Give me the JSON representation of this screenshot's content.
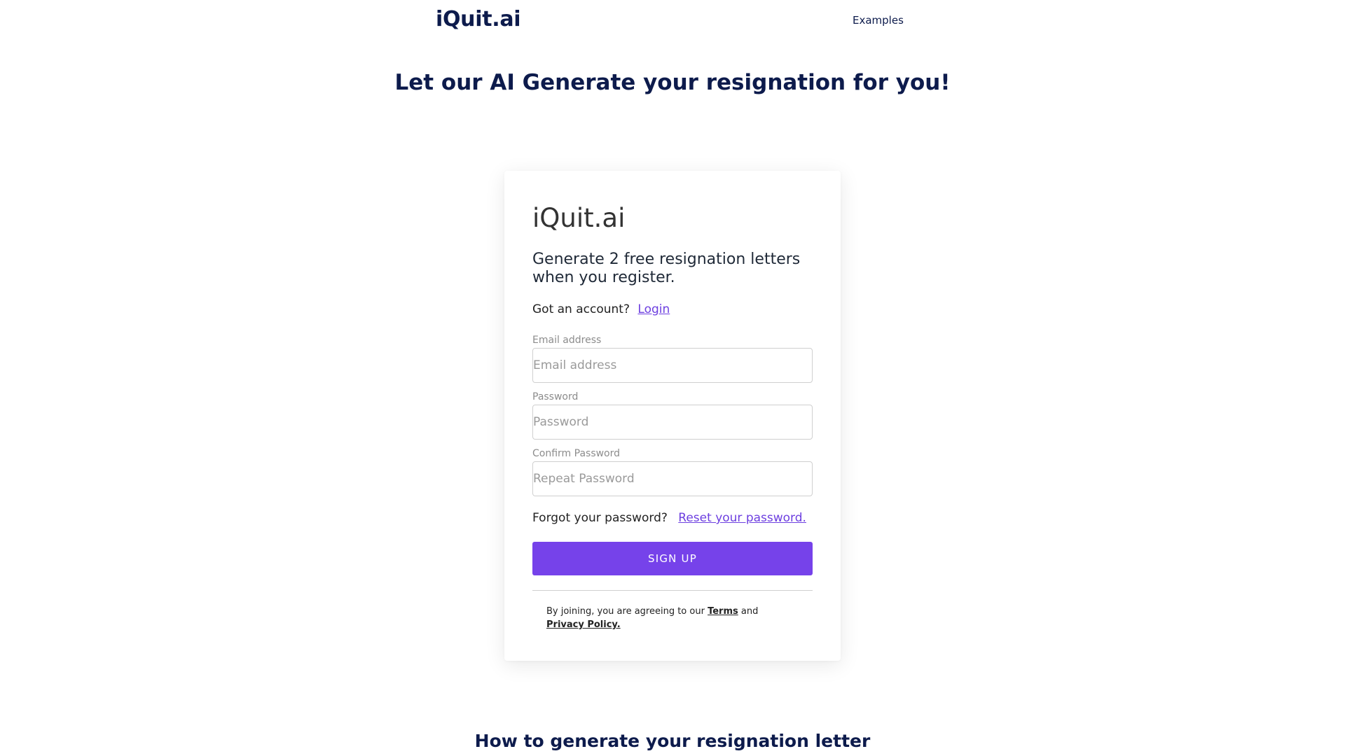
{
  "header": {
    "logo": "iQuit.ai",
    "nav_examples": "Examples"
  },
  "hero": {
    "title": "Let our AI Generate your resignation for you!"
  },
  "signup_card": {
    "brand": "iQuit.ai",
    "tagline": "Generate 2 free resignation letters when you register.",
    "account_prompt": "Got an account?",
    "login_link": "Login",
    "fields": {
      "email": {
        "label": "Email address",
        "placeholder": "Email address",
        "value": ""
      },
      "password": {
        "label": "Password",
        "placeholder": "Password",
        "value": ""
      },
      "confirm_password": {
        "label": "Confirm Password",
        "placeholder": "Repeat Password",
        "value": ""
      }
    },
    "forgot_prompt": "Forgot your password?",
    "reset_link": "Reset your password.",
    "signup_button": "SIGN UP",
    "legal": {
      "prefix": "By joining, you are agreeing to our",
      "terms": "Terms",
      "and": "and",
      "privacy": "Privacy Policy."
    }
  },
  "section": {
    "how_heading": "How to generate your resignation letter"
  },
  "colors": {
    "brand_navy": "#0d1b4c",
    "accent_purple": "#7642ea",
    "link_purple": "#6d3fe0"
  }
}
